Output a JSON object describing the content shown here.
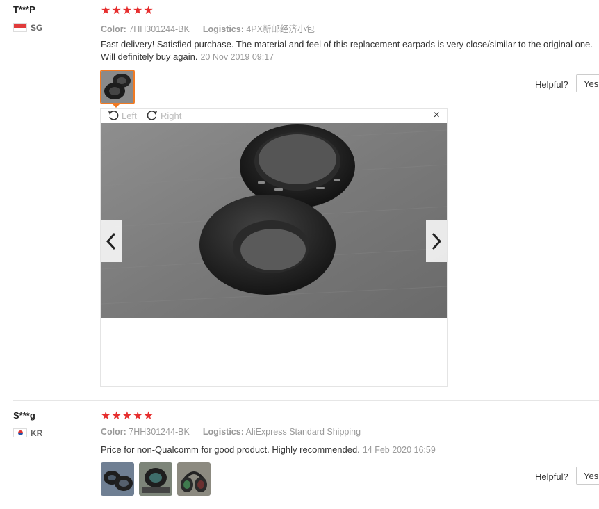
{
  "reviews": [
    {
      "user": "T***P",
      "country": "SG",
      "stars": "★★★★★",
      "color_label": "Color:",
      "color_value": "7HH301244-BK",
      "logistics_label": "Logistics:",
      "logistics_value": "4PX新邮经济小包",
      "text": "Fast delivery! Satisfied purchase. The material and feel of this replacement earpads is very close/similar to the original one. Will definitely buy again.",
      "date": "20 Nov 2019 09:17",
      "helpful_label": "Helpful?",
      "yes_label": "Yes"
    },
    {
      "user": "S***g",
      "country": "KR",
      "stars": "★★★★★",
      "color_label": "Color:",
      "color_value": "7HH301244-BK",
      "logistics_label": "Logistics:",
      "logistics_value": "AliExpress Standard Shipping",
      "text": "Price for non-Qualcomm for good product. Highly recommended.",
      "date": "14 Feb 2020 16:59",
      "helpful_label": "Helpful?",
      "yes_label": "Yes"
    }
  ],
  "viewer": {
    "rotate_left_label": "Left",
    "rotate_right_label": "Right",
    "close_glyph": "×",
    "photo_icon": "earpads-photo"
  },
  "colors": {
    "star": "#e62e2e",
    "active_thumb_border": "#f07a23",
    "muted_text": "#999999"
  }
}
